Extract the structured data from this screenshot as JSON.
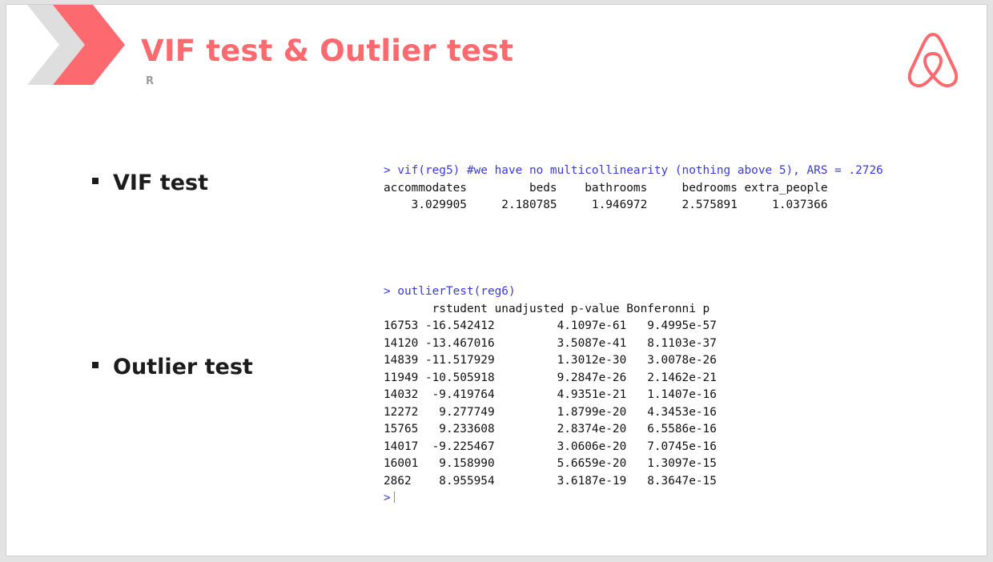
{
  "header": {
    "title": "VIF test & Outlier test",
    "subtitle": "R"
  },
  "logo": {
    "icon": "airbnb-logo-icon",
    "color": "#fc6a6f"
  },
  "bullets": [
    {
      "label": "VIF test"
    },
    {
      "label": "Outlier test"
    }
  ],
  "vif_console": {
    "command": "> vif(reg5) #we have no multicollinearity (nothing above 5), ARS = .2726",
    "header": "accommodates         beds    bathrooms     bedrooms extra_people",
    "values": "    3.029905     2.180785     1.946972     2.575891     1.037366"
  },
  "outlier_console": {
    "command": "> outlierTest(reg6)",
    "header": "       rstudent unadjusted p-value Bonferonni p",
    "rows": [
      "16753 -16.542412         4.1097e-61   9.4995e-57",
      "14120 -13.467016         3.5087e-41   8.1103e-37",
      "14839 -11.517929         1.3012e-30   3.0078e-26",
      "11949 -10.505918         9.2847e-26   2.1462e-21",
      "14032  -9.419764         4.9351e-21   1.1407e-16",
      "12272   9.277749         1.8799e-20   4.3453e-16",
      "15765   9.233608         2.8374e-20   6.5586e-16",
      "14017  -9.225467         3.0606e-20   7.0745e-16",
      "16001   9.158990         5.6659e-20   1.3097e-15",
      "2862    8.955954         3.6187e-19   8.3647e-15"
    ],
    "prompt": ">"
  },
  "colors": {
    "accent": "#fc6a6f",
    "chevron_gray": "#dedede",
    "console_command": "#3a3ae0",
    "text": "#1c1c1c"
  }
}
